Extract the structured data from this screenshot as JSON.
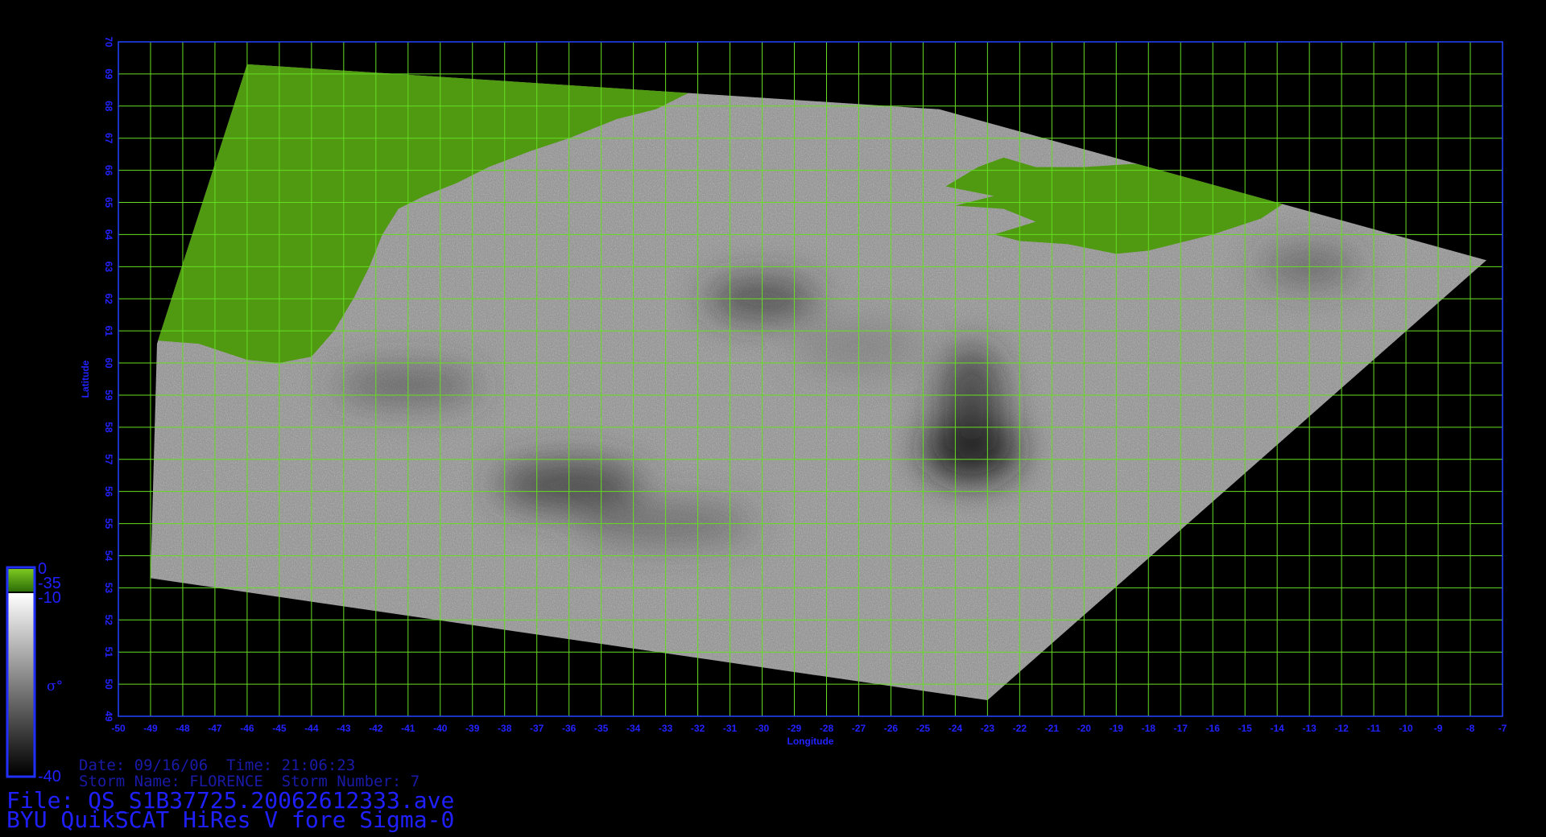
{
  "map": {
    "xaxis": {
      "label": "Longitude",
      "min": -50,
      "max": -7,
      "ticks": [
        "-50",
        "-49",
        "-48",
        "-47",
        "-46",
        "-45",
        "-44",
        "-43",
        "-42",
        "-41",
        "-40",
        "-39",
        "-38",
        "-37",
        "-36",
        "-35",
        "-34",
        "-33",
        "-32",
        "-31",
        "-30",
        "-29",
        "-28",
        "-27",
        "-26",
        "-25",
        "-24",
        "-23",
        "-22",
        "-21",
        "-20",
        "-19",
        "-18",
        "-17",
        "-16",
        "-15",
        "-14",
        "-13",
        "-12",
        "-11",
        "-10",
        "-9",
        "-8",
        "-7"
      ]
    },
    "yaxis": {
      "label": "Latitude",
      "min": 49,
      "max": 70,
      "ticks": [
        "49",
        "50",
        "51",
        "52",
        "53",
        "54",
        "55",
        "56",
        "57",
        "58",
        "59",
        "60",
        "61",
        "62",
        "63",
        "64",
        "65",
        "66",
        "67",
        "68",
        "69",
        "70"
      ]
    },
    "grid": true,
    "grid_color": "#66dd22",
    "frame_color": "#2244ff",
    "label_color": "#2222ff",
    "land_color": "#4f9a10",
    "swath_corners_lonlat": [
      [
        -46,
        69.3
      ],
      [
        -24.5,
        67.9
      ],
      [
        -7.5,
        63.2
      ],
      [
        -23,
        49.5
      ],
      [
        -49,
        53.3
      ],
      [
        -48.8,
        60.6
      ]
    ],
    "swath_description": "Gray-scale backscatter swath with green land masks over Greenland coast and Iceland"
  },
  "colorbar": {
    "labels_top": [
      "0",
      "-35",
      "-10"
    ],
    "label_bottom": "-40",
    "symbol": "σ°",
    "colors": {
      "land": "#4fa010",
      "high": "#ffffff",
      "low": "#000000"
    }
  },
  "info": {
    "date_line": "Date: 09/16/06  Time: 21:06:23",
    "storm_line": "Storm Name: FLORENCE  Storm Number: 7",
    "file_line": "File: QS_S1B37725.20062612333.ave",
    "title_line": "BYU QuikSCAT HiRes V fore Sigma-0"
  }
}
